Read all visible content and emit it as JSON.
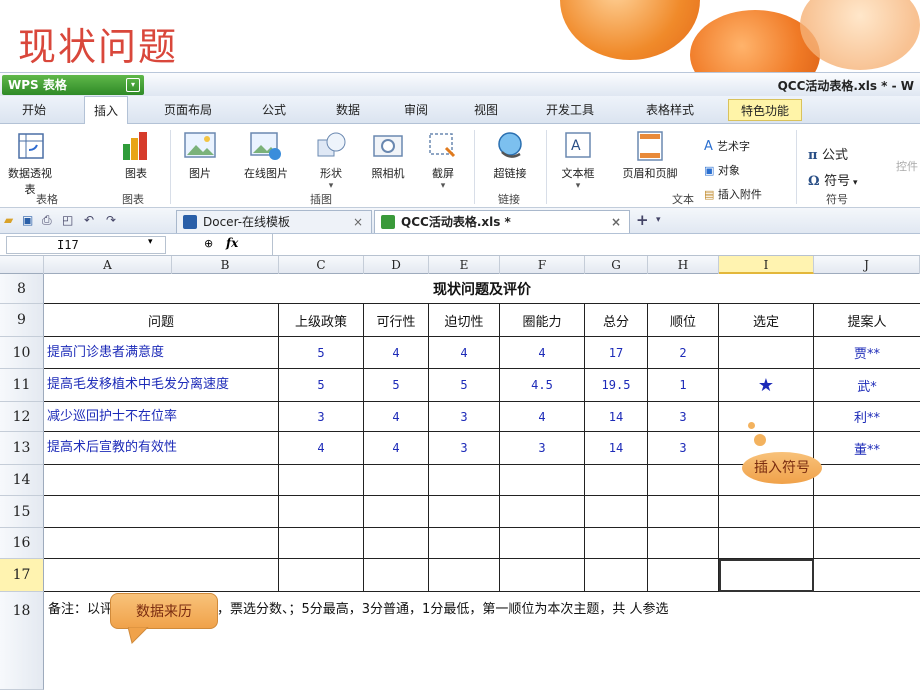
{
  "slide_title": "现状问题",
  "app": {
    "name": "WPS 表格",
    "doc_title": "QCC活动表格.xls * - W"
  },
  "menu": [
    "开始",
    "插入",
    "页面布局",
    "公式",
    "数据",
    "审阅",
    "视图",
    "开发工具",
    "表格样式",
    "特色功能"
  ],
  "ribbon": {
    "buttons": [
      "数据透视表",
      "图表",
      "图片",
      "在线图片",
      "形状",
      "照相机",
      "截屏",
      "超链接",
      "文本框",
      "页眉和页脚"
    ],
    "small": {
      "art_text": "艺术字",
      "object": "对象",
      "attach": "插入附件",
      "formula": "公式",
      "symbol": "符号",
      "control": "控件"
    },
    "groups": [
      "表格",
      "图表",
      "插图",
      "链接",
      "文本",
      "符号"
    ]
  },
  "doc_tabs": [
    {
      "label": "Docer-在线模板"
    },
    {
      "label": "QCC活动表格.xls *"
    }
  ],
  "formula_bar": {
    "cell_ref": "I17",
    "fx": "fx"
  },
  "columns": [
    "A",
    "B",
    "C",
    "D",
    "E",
    "F",
    "G",
    "H",
    "I",
    "J"
  ],
  "rows": [
    "8",
    "9",
    "10",
    "11",
    "12",
    "13",
    "14",
    "15",
    "16",
    "17",
    "18"
  ],
  "sheet": {
    "title": "现状问题及评价",
    "headers": [
      "问题",
      "上级政策",
      "可行性",
      "迫切性",
      "圈能力",
      "总分",
      "顺位",
      "选定",
      "提案人"
    ],
    "data": [
      {
        "q": "提高门诊患者满意度",
        "c": "5",
        "d": "4",
        "e": "4",
        "f": "4",
        "g": "17",
        "h": "2",
        "i": "",
        "j": "贾**"
      },
      {
        "q": "提高毛发移植术中毛发分离速度",
        "c": "5",
        "d": "5",
        "e": "5",
        "f": "4.5",
        "g": "19.5",
        "h": "1",
        "i": "★",
        "j": "武*"
      },
      {
        "q": "减少巡回护士不在位率",
        "c": "3",
        "d": "4",
        "e": "3",
        "f": "4",
        "g": "14",
        "h": "3",
        "i": "",
        "j": "利**"
      },
      {
        "q": "提高术后宣教的有效性",
        "c": "4",
        "d": "4",
        "e": "3",
        "f": "3",
        "g": "14",
        "h": "3",
        "i": "",
        "j": "董**"
      }
    ],
    "note": "备注：以评价法进行主题评价，票选分数、；5分最高，3分普通，1分最低，第一顺位为本次主题，共  人参选"
  },
  "callouts": {
    "insert_symbol": "插入符号",
    "data_source": "数据来历"
  },
  "colors": {
    "title": "#d9473b",
    "accent_blue": "#1d2bb8",
    "callout": "#f0a24a"
  }
}
